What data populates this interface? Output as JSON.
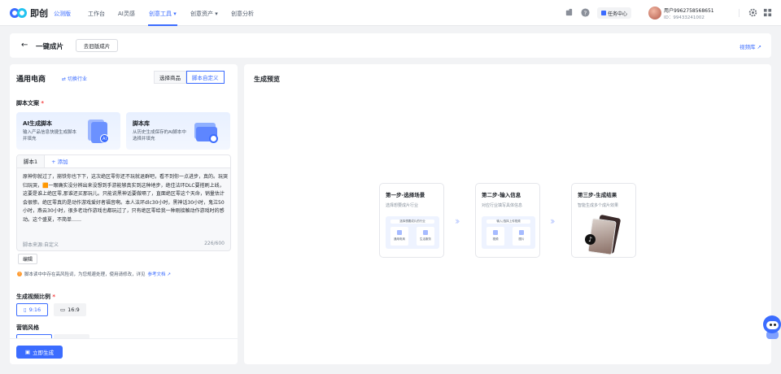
{
  "nav": {
    "brand": "即创",
    "edition": "公测版",
    "items": [
      "工作台",
      "AI灵感",
      "创意工具 ▾",
      "创意资产 ▾",
      "创意分析"
    ],
    "task_center": "任务中心",
    "user_name": "用户9962758568651",
    "user_id": "ID：99433241002"
  },
  "header": {
    "back": "←",
    "title": "一键成片",
    "old_version": "去旧版成片",
    "video_library": "视频库 ↗"
  },
  "left": {
    "industry": "通用电商",
    "switch_industry": "切换行业",
    "mode_tabs": [
      "选择商品",
      "脚本自定义"
    ],
    "script_section": "脚本文案",
    "cards": [
      {
        "title": "AI生成脚本",
        "desc": "输入产品信息快捷生成脚本并填充",
        "badge": "AI"
      },
      {
        "title": "脚本库",
        "desc": "从历史生成保存的AI脚本中选择并填充"
      }
    ],
    "script_tab": "脚本1",
    "add_tab": "+ 添加",
    "script_text": "原神你就过了，崩铁你也下下，这次绝区零你还不玩就退群吧，看不到你一点进步，真的。玩哭归玩哭，🟧一眼确实没分辨出来没想到手游能够真实到这种地步，绝佳法环DLC要搭刷上线，这要是谁上绝区零,那谁还买那玩儿。只能说黑神话要做嗝了，直面绝区零这个天命，销量估计会很惨。绝区零真的是动作游戏爱好者福音啊。本人法环dlc30小时，黑神话30小时，鬼泣50小时，燕云30小时，很多老动作游戏也都玩过了，只有绝区零给我一种刚接触动作游戏时的感动。这个盛夏，不简单……",
    "script_source": "脚本来源:自定义",
    "script_count": "226/600",
    "edit": "编辑",
    "note": "脚本读中中存在高风险词，为您规避处理，使用请修改，详见",
    "note_link": "参考文档 ↗",
    "ratio_label": "生成视频比例",
    "ratios": [
      "9:16",
      "16:9"
    ],
    "style_label": "营销风格",
    "generate": "立即生成"
  },
  "right": {
    "title": "生成预览",
    "steps": [
      {
        "title": "第一步-选择场景",
        "desc": "选择想要成片行业",
        "mock_title": "选择想要成片的行业",
        "tiles": [
          "通用电商",
          "生活服务"
        ]
      },
      {
        "title": "第二步-输入信息",
        "desc": "对应行业填写具体信息",
        "mock_title": "输入/选择上传视频",
        "tiles": [
          "视频",
          "图片"
        ]
      },
      {
        "title": "第三步-生成结果",
        "desc": "智能生成多个成片效果"
      }
    ]
  },
  "colors": {
    "accent": "#3b6cff",
    "required": "#f53f3f",
    "warning": "#ff9a2e"
  }
}
